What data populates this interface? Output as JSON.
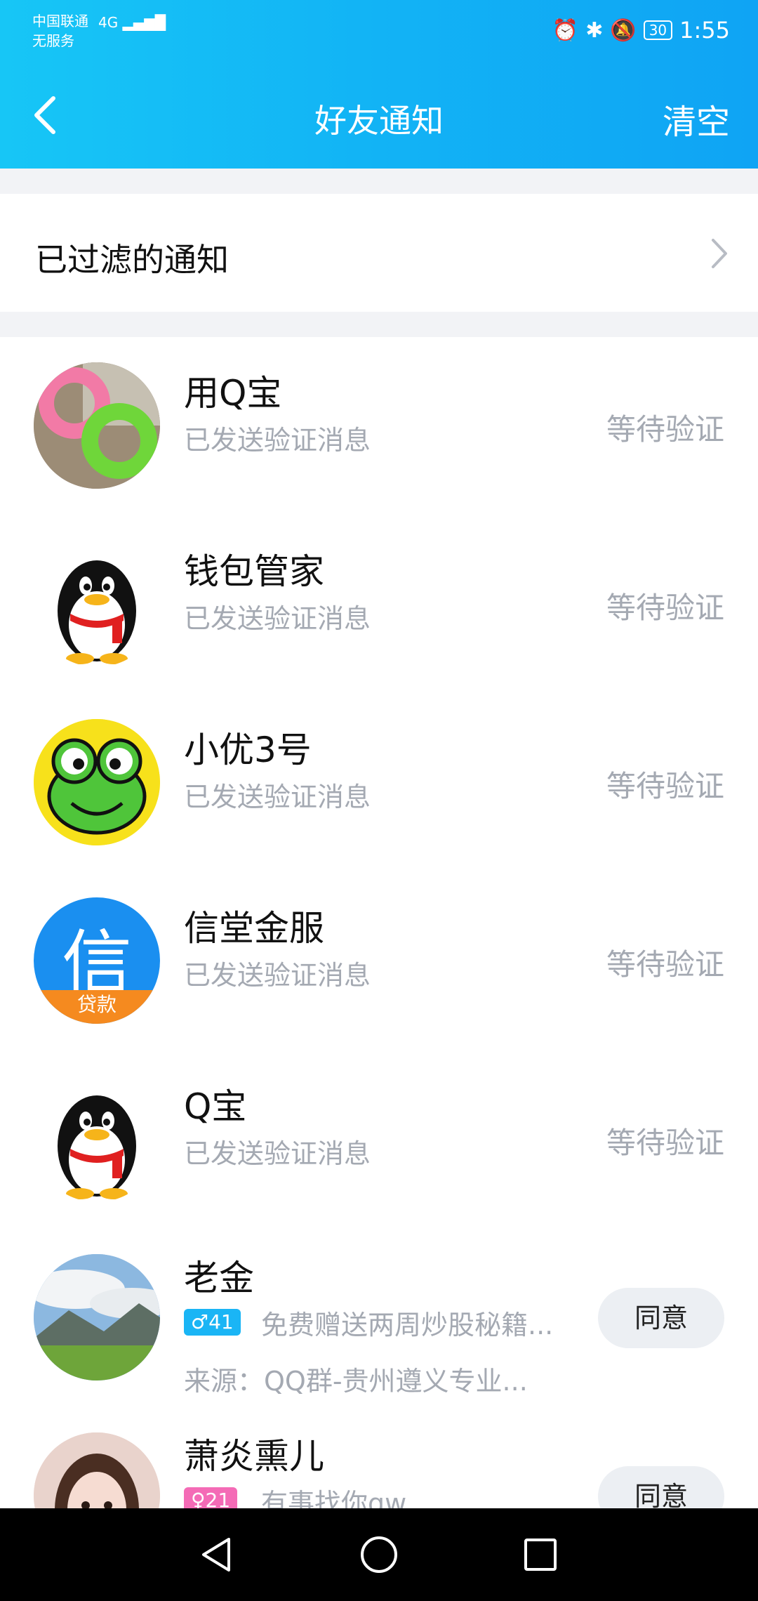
{
  "status_bar": {
    "carrier": "中国联通",
    "service": "无服务",
    "network": "4G",
    "battery": "30",
    "time": "1:55"
  },
  "header": {
    "title": "好友通知",
    "clear_label": "清空"
  },
  "filtered": {
    "label": "已过滤的通知"
  },
  "notifications": [
    {
      "name": "用Q宝",
      "sub": "已发送验证消息",
      "status": "等待验证",
      "avatar": "pink-green-rings-avatar"
    },
    {
      "name": "钱包管家",
      "sub": "已发送验证消息",
      "status": "等待验证",
      "avatar": "penguin-avatar"
    },
    {
      "name": "小优3号",
      "sub": "已发送验证消息",
      "status": "等待验证",
      "avatar": "frog-avatar"
    },
    {
      "name": "信堂金服",
      "sub": "已发送验证消息",
      "status": "等待验证",
      "avatar": "xin-loan-avatar",
      "avatar_text": "信",
      "avatar_sub": "贷款"
    },
    {
      "name": "Q宝",
      "sub": "已发送验证消息",
      "status": "等待验证",
      "avatar": "penguin-avatar"
    },
    {
      "name": "老金",
      "badge": "♂41",
      "message": "免费赠送两周炒股秘籍...",
      "source": "来源：QQ群-贵州遵义专业...",
      "action": "同意",
      "avatar": "mountain-avatar"
    },
    {
      "name": "萧炎熏儿",
      "badge": "♀21",
      "message": "有事找你qw",
      "action": "同意",
      "avatar": "girl-avatar"
    }
  ],
  "colors": {
    "header_start": "#17c6f6",
    "header_end": "#0fa4f4",
    "muted_text": "#a4a9b2",
    "badge_male": "#1ab5f5",
    "badge_female": "#f46bb6"
  }
}
